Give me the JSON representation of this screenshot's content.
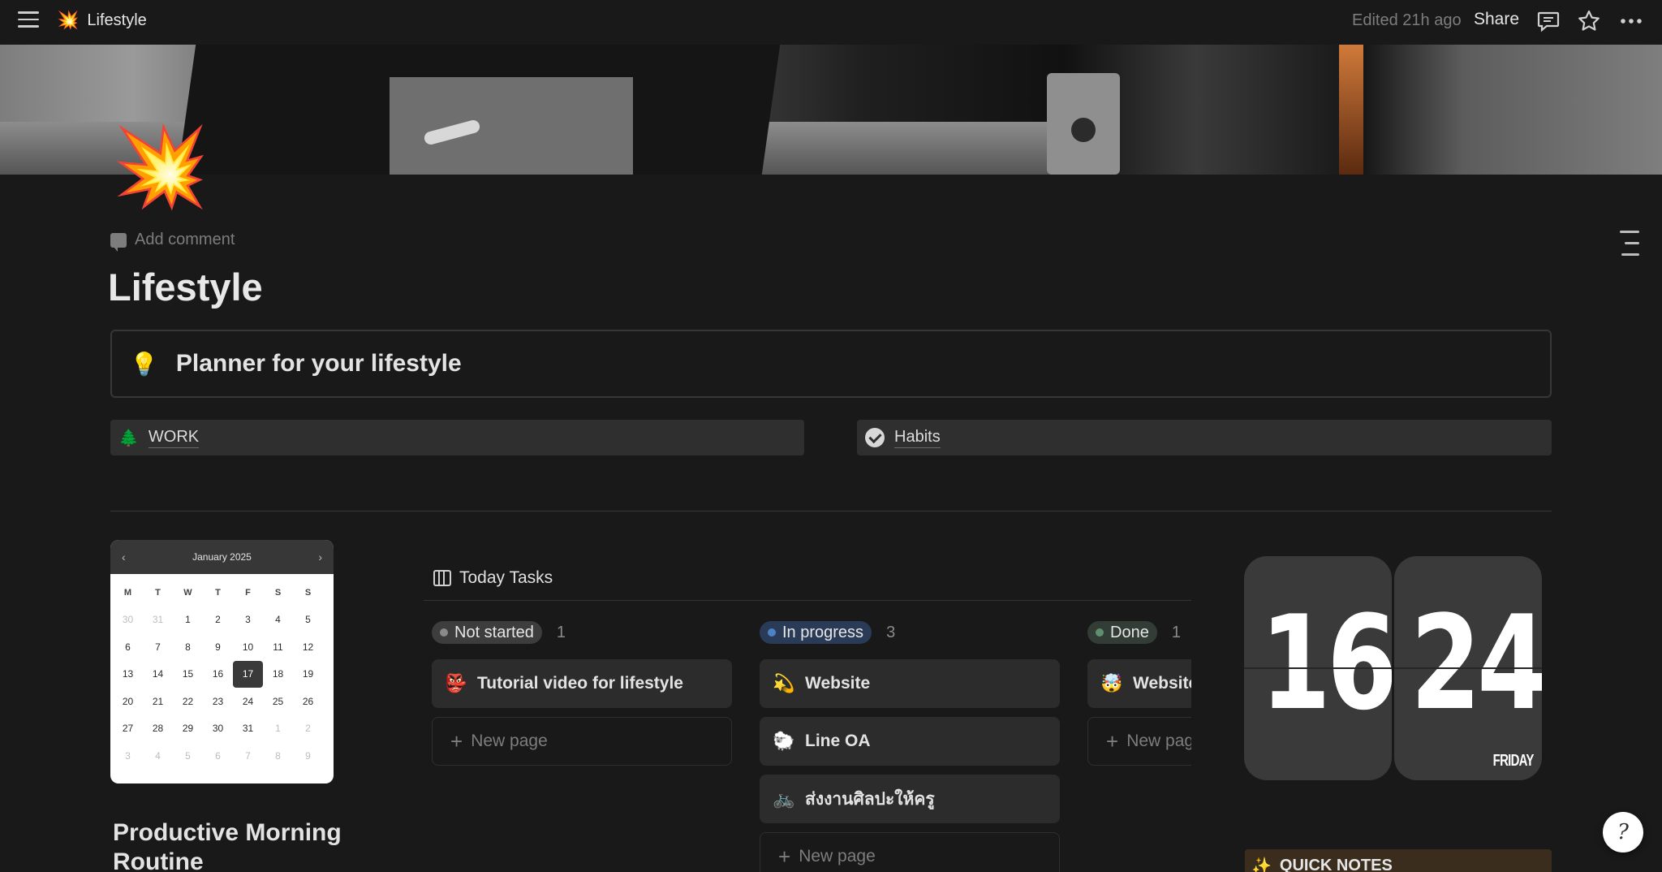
{
  "topbar": {
    "page_emoji": "💥",
    "page_title": "Lifestyle",
    "edited": "Edited 21h ago",
    "share_label": "Share"
  },
  "page": {
    "icon": "💥",
    "add_comment": "Add comment",
    "title": "Lifestyle"
  },
  "callout": {
    "icon": "💡",
    "text": "Planner for your lifestyle"
  },
  "links": [
    {
      "icon": "🌲",
      "label": "WORK"
    },
    {
      "icon": "check-circle-icon",
      "label": "Habits"
    }
  ],
  "calendar": {
    "month": "January 2025",
    "prev": "‹",
    "next": "›",
    "weekdays": [
      "M",
      "T",
      "W",
      "T",
      "F",
      "S",
      "S"
    ],
    "days": [
      {
        "d": "30",
        "m": true
      },
      {
        "d": "31",
        "m": true
      },
      {
        "d": "1"
      },
      {
        "d": "2"
      },
      {
        "d": "3"
      },
      {
        "d": "4"
      },
      {
        "d": "5"
      },
      {
        "d": "6"
      },
      {
        "d": "7"
      },
      {
        "d": "8"
      },
      {
        "d": "9"
      },
      {
        "d": "10"
      },
      {
        "d": "11"
      },
      {
        "d": "12"
      },
      {
        "d": "13"
      },
      {
        "d": "14"
      },
      {
        "d": "15"
      },
      {
        "d": "16"
      },
      {
        "d": "17",
        "today": true
      },
      {
        "d": "18"
      },
      {
        "d": "19"
      },
      {
        "d": "20"
      },
      {
        "d": "21"
      },
      {
        "d": "22"
      },
      {
        "d": "23"
      },
      {
        "d": "24"
      },
      {
        "d": "25"
      },
      {
        "d": "26"
      },
      {
        "d": "27"
      },
      {
        "d": "28"
      },
      {
        "d": "29"
      },
      {
        "d": "30"
      },
      {
        "d": "31"
      },
      {
        "d": "1",
        "m": true
      },
      {
        "d": "2",
        "m": true
      },
      {
        "d": "3",
        "m": true
      },
      {
        "d": "4",
        "m": true
      },
      {
        "d": "5",
        "m": true
      },
      {
        "d": "6",
        "m": true
      },
      {
        "d": "7",
        "m": true
      },
      {
        "d": "8",
        "m": true
      },
      {
        "d": "9",
        "m": true
      }
    ]
  },
  "routine": {
    "title": "Productive Morning Routine"
  },
  "board": {
    "title": "Today Tasks",
    "new_page": "New page",
    "columns": [
      {
        "status": "Not started",
        "count": "1",
        "pill_color": "#3d3d3d",
        "dot_color": "#8a8a8a",
        "cards": [
          {
            "emoji": "👺",
            "title": "Tutorial video for lifestyle"
          }
        ]
      },
      {
        "status": "In progress",
        "count": "3",
        "pill_color": "#2a3b57",
        "dot_color": "#4d82c8",
        "cards": [
          {
            "emoji": "💫",
            "title": "Website"
          },
          {
            "emoji": "🐑",
            "title": "Line OA"
          },
          {
            "emoji": "🚲",
            "title": "ส่งงานศิลปะให้ครู"
          }
        ]
      },
      {
        "status": "Done",
        "count": "1",
        "pill_color": "#323d35",
        "dot_color": "#5f8f6e",
        "cards": [
          {
            "emoji": "🤯",
            "title": "Website"
          }
        ]
      }
    ]
  },
  "clock": {
    "hours": "16",
    "minutes": "24",
    "day": "FRIDAY"
  },
  "quick_notes": {
    "icon": "✨",
    "label": "QUICK NOTES"
  },
  "help": {
    "glyph": "?"
  }
}
